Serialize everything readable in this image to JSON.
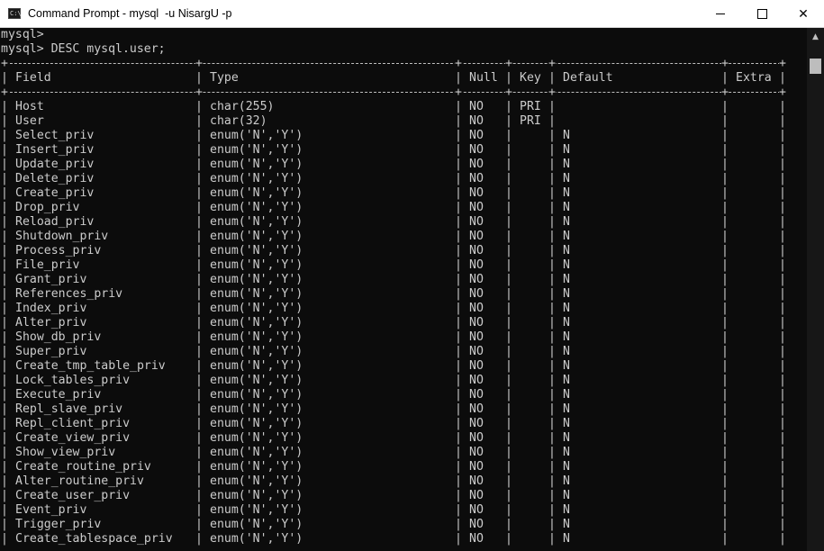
{
  "window": {
    "title": "Command Prompt - mysql  -u NisargU -p",
    "icon_glyph": "C:\\",
    "minimize_icon": "minimize-icon",
    "maximize_icon": "maximize-icon",
    "close_glyph": "✕"
  },
  "prompt_lines": [
    "mysql>",
    "mysql> DESC mysql.user;"
  ],
  "table": {
    "headers": [
      "Field",
      "Type",
      "Null",
      "Key",
      "Default",
      "Extra"
    ],
    "rows": [
      [
        "Host",
        "char(255)",
        "NO",
        "PRI",
        "",
        ""
      ],
      [
        "User",
        "char(32)",
        "NO",
        "PRI",
        "",
        ""
      ],
      [
        "Select_priv",
        "enum('N','Y')",
        "NO",
        "",
        "N",
        ""
      ],
      [
        "Insert_priv",
        "enum('N','Y')",
        "NO",
        "",
        "N",
        ""
      ],
      [
        "Update_priv",
        "enum('N','Y')",
        "NO",
        "",
        "N",
        ""
      ],
      [
        "Delete_priv",
        "enum('N','Y')",
        "NO",
        "",
        "N",
        ""
      ],
      [
        "Create_priv",
        "enum('N','Y')",
        "NO",
        "",
        "N",
        ""
      ],
      [
        "Drop_priv",
        "enum('N','Y')",
        "NO",
        "",
        "N",
        ""
      ],
      [
        "Reload_priv",
        "enum('N','Y')",
        "NO",
        "",
        "N",
        ""
      ],
      [
        "Shutdown_priv",
        "enum('N','Y')",
        "NO",
        "",
        "N",
        ""
      ],
      [
        "Process_priv",
        "enum('N','Y')",
        "NO",
        "",
        "N",
        ""
      ],
      [
        "File_priv",
        "enum('N','Y')",
        "NO",
        "",
        "N",
        ""
      ],
      [
        "Grant_priv",
        "enum('N','Y')",
        "NO",
        "",
        "N",
        ""
      ],
      [
        "References_priv",
        "enum('N','Y')",
        "NO",
        "",
        "N",
        ""
      ],
      [
        "Index_priv",
        "enum('N','Y')",
        "NO",
        "",
        "N",
        ""
      ],
      [
        "Alter_priv",
        "enum('N','Y')",
        "NO",
        "",
        "N",
        ""
      ],
      [
        "Show_db_priv",
        "enum('N','Y')",
        "NO",
        "",
        "N",
        ""
      ],
      [
        "Super_priv",
        "enum('N','Y')",
        "NO",
        "",
        "N",
        ""
      ],
      [
        "Create_tmp_table_priv",
        "enum('N','Y')",
        "NO",
        "",
        "N",
        ""
      ],
      [
        "Lock_tables_priv",
        "enum('N','Y')",
        "NO",
        "",
        "N",
        ""
      ],
      [
        "Execute_priv",
        "enum('N','Y')",
        "NO",
        "",
        "N",
        ""
      ],
      [
        "Repl_slave_priv",
        "enum('N','Y')",
        "NO",
        "",
        "N",
        ""
      ],
      [
        "Repl_client_priv",
        "enum('N','Y')",
        "NO",
        "",
        "N",
        ""
      ],
      [
        "Create_view_priv",
        "enum('N','Y')",
        "NO",
        "",
        "N",
        ""
      ],
      [
        "Show_view_priv",
        "enum('N','Y')",
        "NO",
        "",
        "N",
        ""
      ],
      [
        "Create_routine_priv",
        "enum('N','Y')",
        "NO",
        "",
        "N",
        ""
      ],
      [
        "Alter_routine_priv",
        "enum('N','Y')",
        "NO",
        "",
        "N",
        ""
      ],
      [
        "Create_user_priv",
        "enum('N','Y')",
        "NO",
        "",
        "N",
        ""
      ],
      [
        "Event_priv",
        "enum('N','Y')",
        "NO",
        "",
        "N",
        ""
      ],
      [
        "Trigger_priv",
        "enum('N','Y')",
        "NO",
        "",
        "N",
        ""
      ],
      [
        "Create_tablespace_priv",
        "enum('N','Y')",
        "NO",
        "",
        "N",
        ""
      ]
    ]
  },
  "scrollbar": {
    "up_arrow": "▲"
  }
}
